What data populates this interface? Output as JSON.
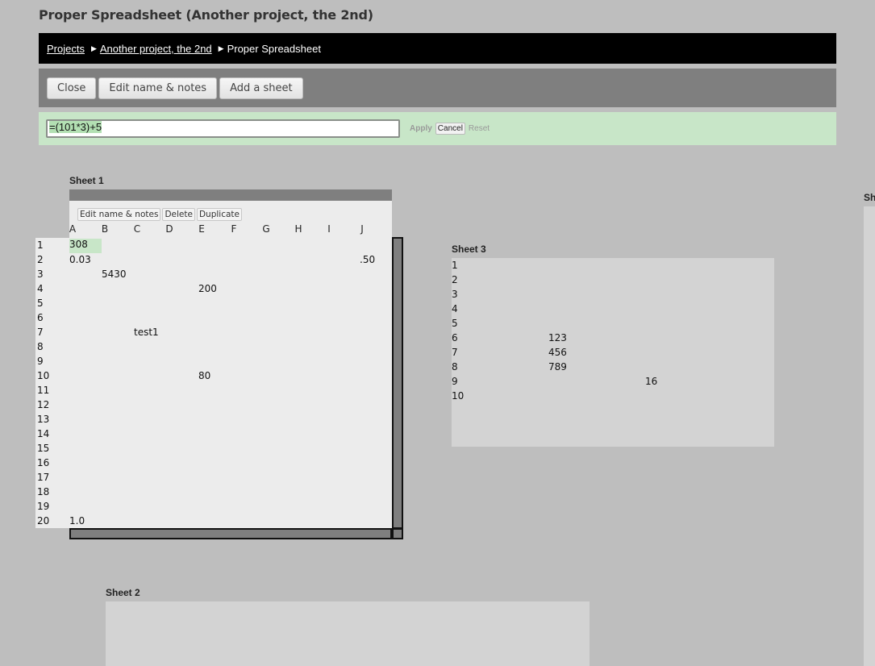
{
  "page": {
    "title": "Proper Spreadsheet (Another project, the 2nd)"
  },
  "breadcrumb": {
    "items": [
      "Projects",
      "Another project, the 2nd"
    ],
    "current": "Proper Spreadsheet",
    "separator": "▶"
  },
  "toolbar": {
    "close_label": "Close",
    "edit_label": "Edit name & notes",
    "add_sheet_label": "Add a sheet"
  },
  "formula_bar": {
    "value": "=(101*3)+5",
    "apply_label": "Apply",
    "cancel_label": "Cancel",
    "reset_label": "Reset"
  },
  "sheet1": {
    "title": "Sheet 1",
    "actions": {
      "edit": "Edit name & notes",
      "delete": "Delete",
      "duplicate": "Duplicate"
    },
    "columns": [
      "A",
      "B",
      "C",
      "D",
      "E",
      "F",
      "G",
      "H",
      "I",
      "J"
    ],
    "rows": [
      "1",
      "2",
      "3",
      "4",
      "5",
      "6",
      "7",
      "8",
      "9",
      "10",
      "11",
      "12",
      "13",
      "14",
      "15",
      "16",
      "17",
      "18",
      "19",
      "20"
    ],
    "cells": {
      "A1": "308",
      "A2": "0.03",
      "J2": ".50",
      "B3": "5430",
      "E4": "200",
      "C7": "test1",
      "E10": "80",
      "A20": "1.0"
    },
    "selected_cell": "A1"
  },
  "sheet3": {
    "title": "Sheet 3",
    "rows": [
      "1",
      "2",
      "3",
      "4",
      "5",
      "6",
      "7",
      "8",
      "9",
      "10"
    ],
    "cells": {
      "r6": "123",
      "r7": "456",
      "r8": "789",
      "r9": "16"
    }
  },
  "sheet2": {
    "title": "Sheet 2"
  },
  "sheet4": {
    "title_fragment": "Sh"
  },
  "colors": {
    "selection": "#c8e6c8",
    "toolbar": "#7f7f7f",
    "breadcrumb_bg": "#000000",
    "background": "#bebebe"
  }
}
